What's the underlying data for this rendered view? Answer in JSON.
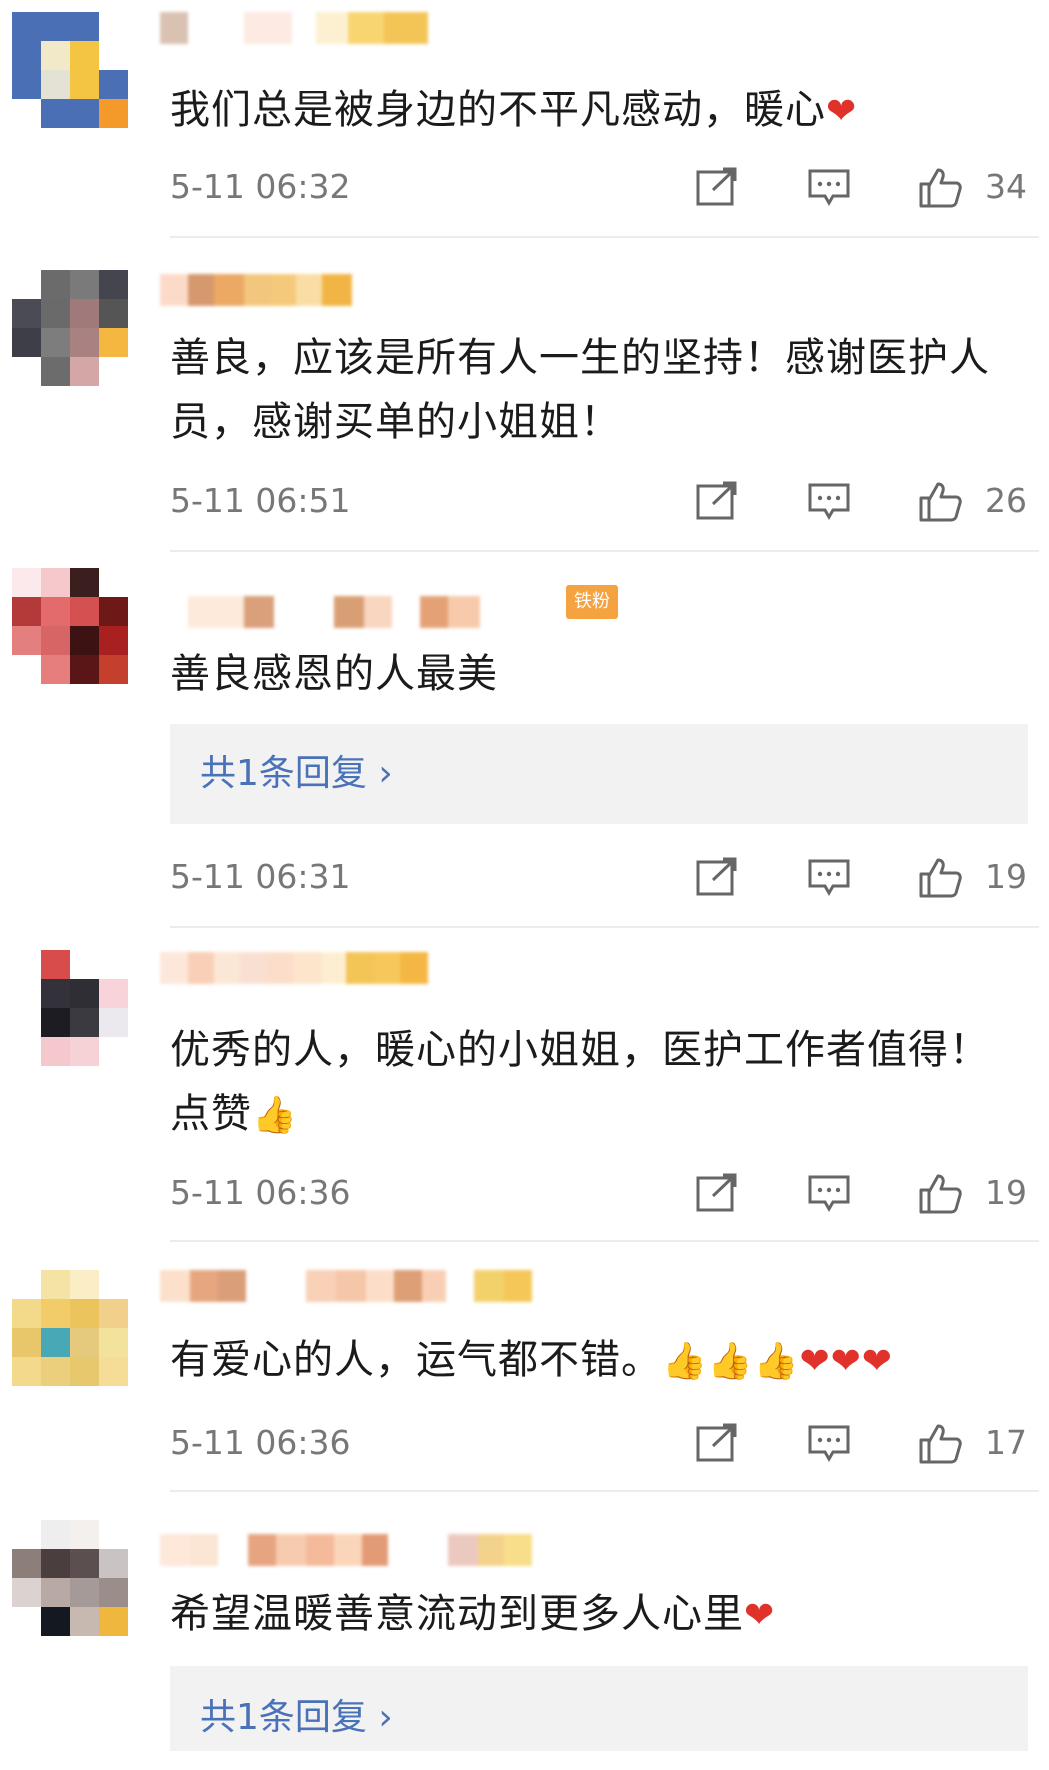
{
  "comments": [
    {
      "text": "我们总是被身边的不平凡感动，暖心",
      "emoji": "❤",
      "emoji_type": "heart",
      "time": "5-11 06:32",
      "likes": "34"
    },
    {
      "text": "善良，应该是所有人一生的坚持！感谢医护人员，感谢买单的小姐姐！",
      "time": "5-11 06:51",
      "likes": "26"
    },
    {
      "text": "善良感恩的人最美",
      "badge": "铁粉",
      "reply_link": "共1条回复 ›",
      "time": "5-11 06:31",
      "likes": "19"
    },
    {
      "text": "优秀的人，暖心的小姐姐，医护工作者值得！点赞",
      "emoji": "👍",
      "emoji_type": "thumb",
      "time": "5-11 06:36",
      "likes": "19"
    },
    {
      "text": "有爱心的人，运气都不错。",
      "emoji": "👍👍👍❤❤❤",
      "emoji_type": "mixed",
      "time": "5-11 06:36",
      "likes": "17"
    },
    {
      "text": "希望温暖善意流动到更多人心里",
      "emoji": "❤",
      "emoji_type": "heart",
      "reply_link": "共1条回复 ›"
    }
  ],
  "icons": {
    "share": "share-icon",
    "reply": "comment-icon",
    "like": "thumbs-up-icon"
  },
  "colors": {
    "link": "#4a72b8",
    "badge": "#f4a340",
    "heart": "#e0312b",
    "meta": "#777777"
  }
}
